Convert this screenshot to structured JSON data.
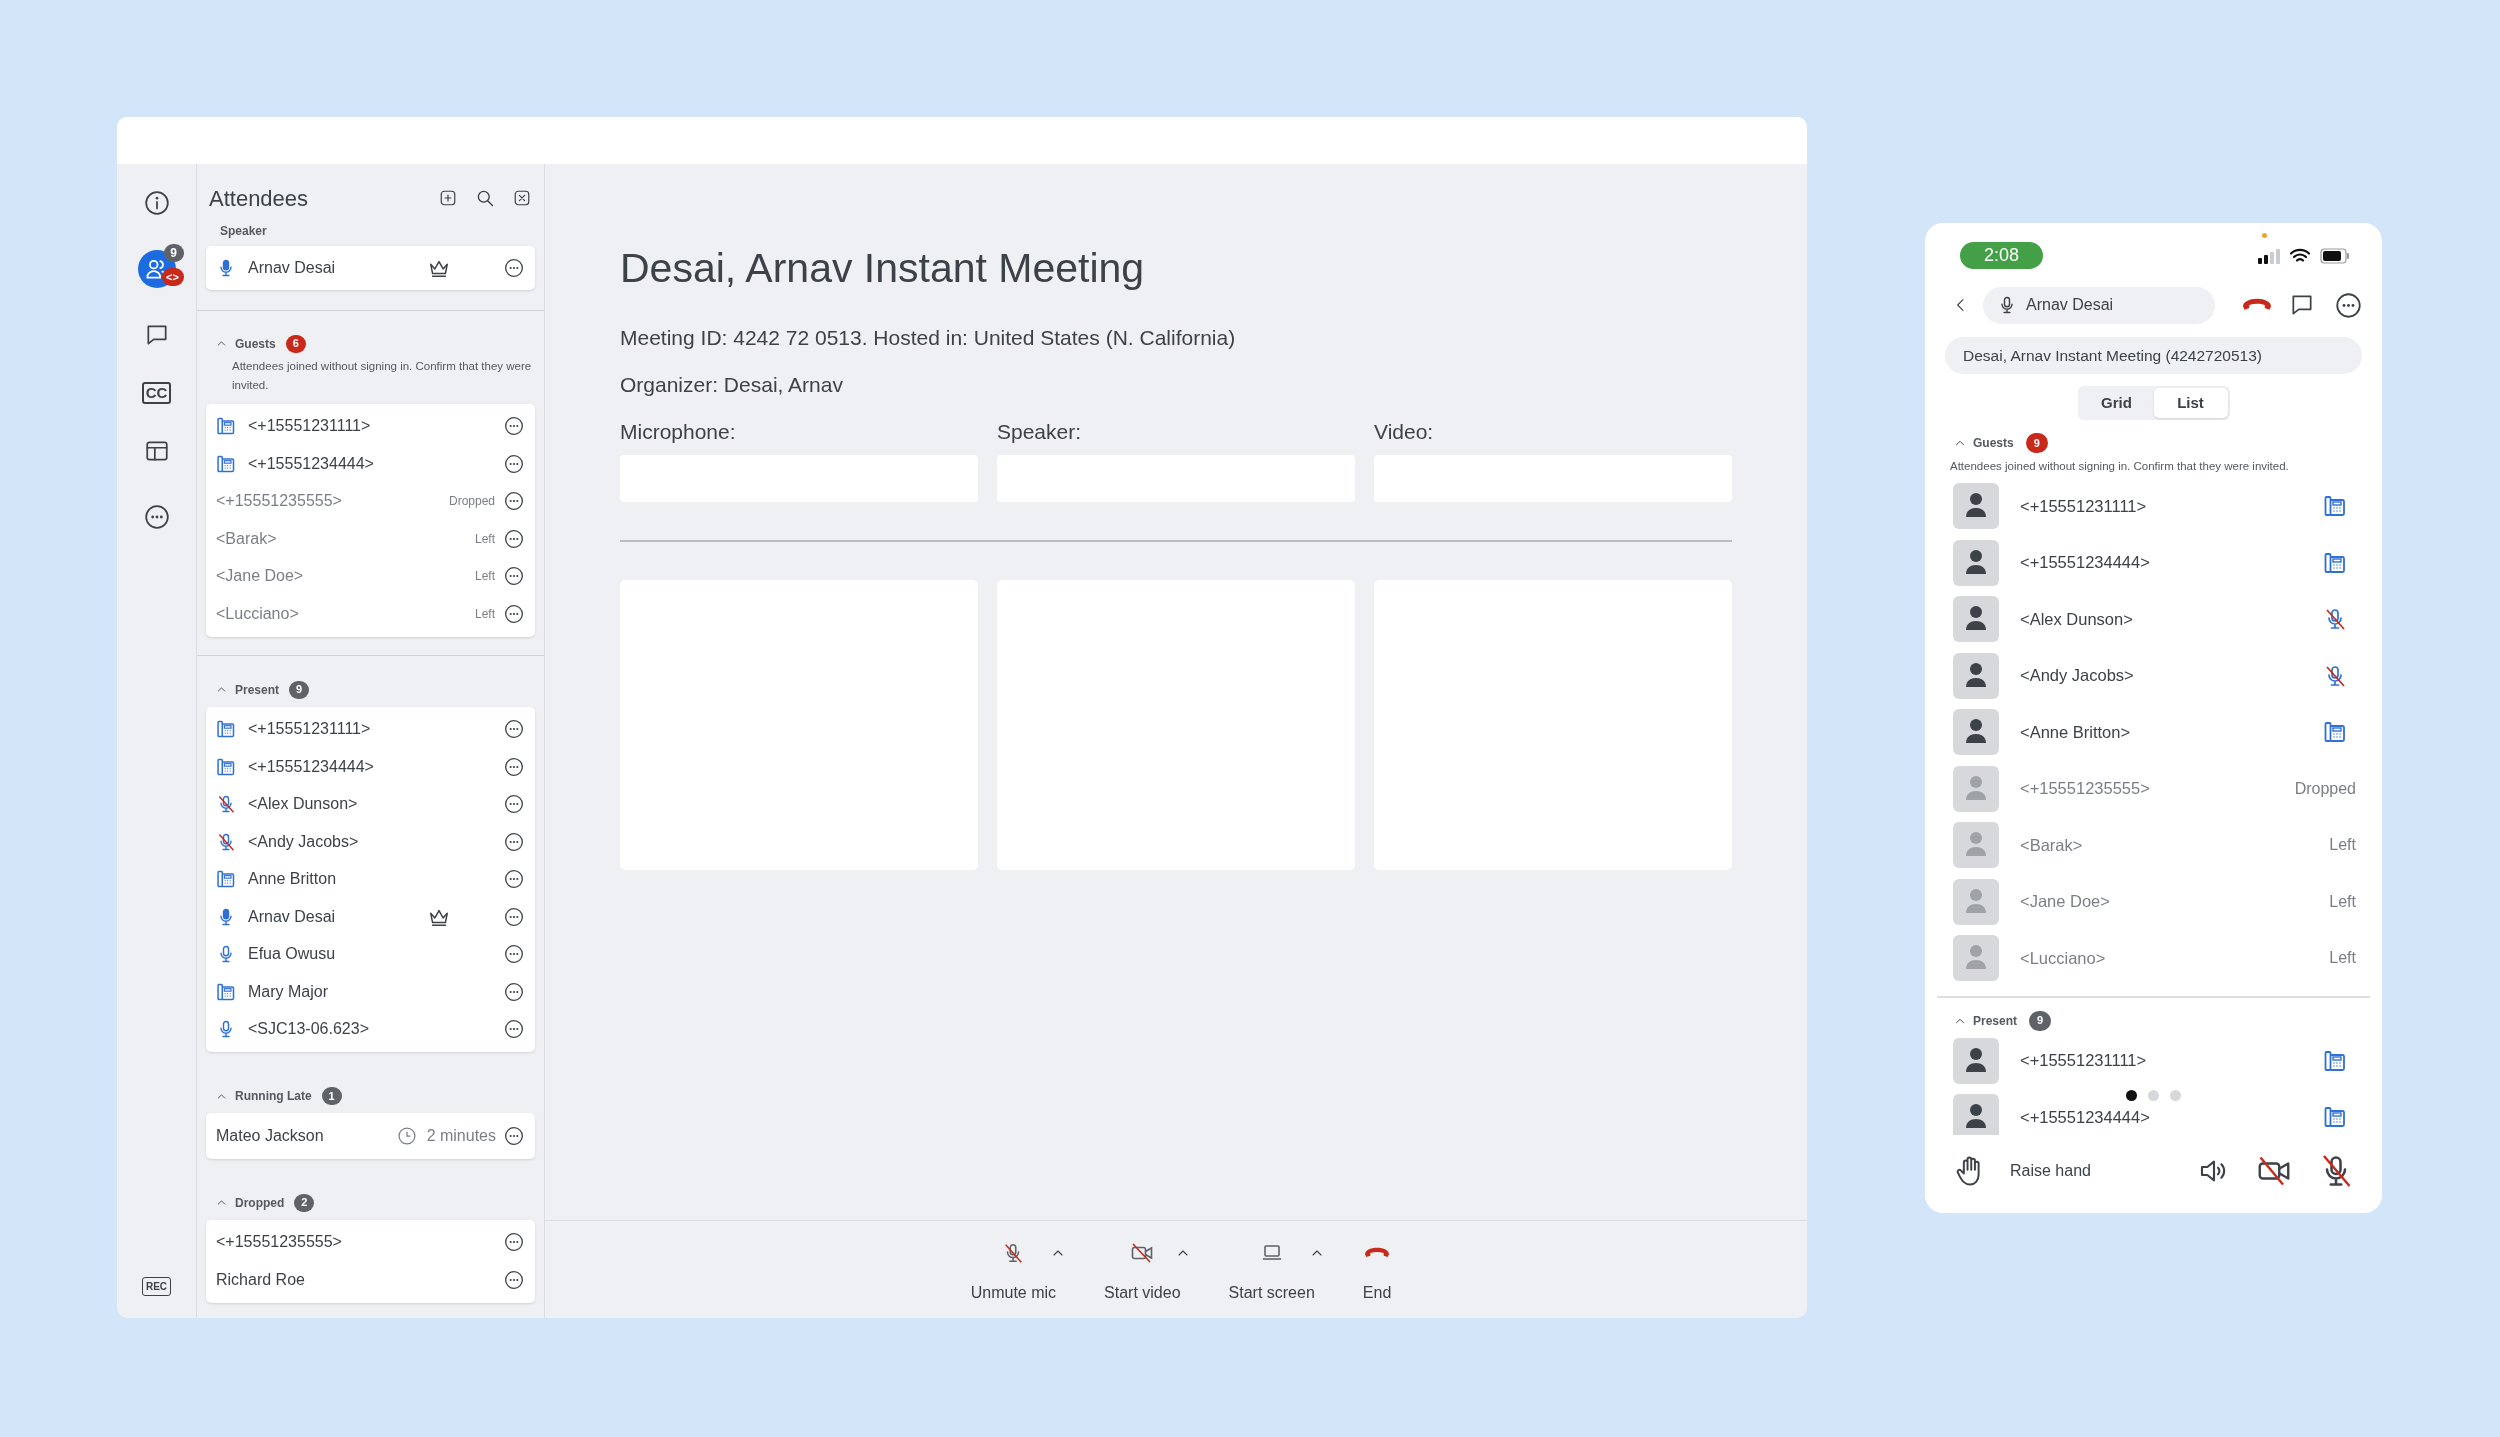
{
  "rail": {
    "items": [
      {
        "kind": "info",
        "selected": false
      },
      {
        "kind": "attendees",
        "selected": true,
        "count": "9",
        "alert": "<>"
      },
      {
        "kind": "chat",
        "selected": false
      },
      {
        "kind": "captions",
        "selected": false,
        "label": "CC"
      },
      {
        "kind": "layout",
        "selected": false
      },
      {
        "kind": "more",
        "selected": false
      },
      {
        "kind": "record",
        "selected": false,
        "label": "REC"
      }
    ]
  },
  "attendees": {
    "title": "Attendees",
    "speaker_label": "Speaker",
    "speaker": {
      "name": "Arnav Desai",
      "kind": "mic_speaking",
      "host": true
    },
    "sections": [
      {
        "title": "Guests",
        "count": "6",
        "alert": true,
        "expanded": true,
        "divider": true,
        "note": "Attendees joined without signing in. Confirm that they were invited.",
        "rows": [
          {
            "name": "<+15551231111>",
            "kind": "desk_phone",
            "inactive": false
          },
          {
            "name": "<+15551234444>",
            "kind": "desk_phone",
            "inactive": false
          },
          {
            "name": "<+15551235555>",
            "status": "Dropped",
            "inactive": true
          },
          {
            "name": "<Barak>",
            "status": "Left",
            "inactive": true
          },
          {
            "name": "<Jane Doe>",
            "status": "Left",
            "inactive": true
          },
          {
            "name": "<Lucciano>",
            "status": "Left",
            "inactive": true
          }
        ]
      },
      {
        "title": "Present",
        "count": "9",
        "alert": false,
        "expanded": true,
        "divider": false,
        "rows": [
          {
            "name": "<+15551231111>",
            "kind": "desk_phone",
            "inactive": false
          },
          {
            "name": "<+15551234444>",
            "kind": "desk_phone",
            "inactive": false
          },
          {
            "name": "<Alex Dunson>",
            "kind": "mic_muted",
            "inactive": false
          },
          {
            "name": "<Andy Jacobs>",
            "kind": "mic_muted",
            "inactive": false
          },
          {
            "name": "Anne Britton",
            "kind": "desk_phone",
            "inactive": false
          },
          {
            "name": "Arnav Desai",
            "kind": "mic_speaking",
            "host": true,
            "inactive": false
          },
          {
            "name": "Efua Owusu",
            "kind": "mic",
            "inactive": false
          },
          {
            "name": "Mary Major",
            "kind": "desk_phone",
            "inactive": false
          },
          {
            "name": "<SJC13-06.623>",
            "kind": "mic",
            "inactive": false
          }
        ]
      },
      {
        "title": "Running Late",
        "count": "1",
        "alert": false,
        "expanded": true,
        "divider": false,
        "rows": [
          {
            "name": "Mateo Jackson",
            "late_by": "2 minutes",
            "inactive": false
          }
        ]
      },
      {
        "title": "Dropped",
        "count": "2",
        "alert": false,
        "expanded": true,
        "divider": false,
        "rows": [
          {
            "name": "<+15551235555>",
            "inactive": false
          },
          {
            "name": "Richard Roe",
            "inactive": false
          }
        ]
      }
    ]
  },
  "meeting": {
    "title": "Desai, Arnav Instant Meeting",
    "details": "Meeting ID: 4242 72 0513. Hosted in: United States (N. California)",
    "organizer": "Organizer: Desai, Arnav",
    "devices": [
      {
        "label": "Microphone:"
      },
      {
        "label": "Speaker:"
      },
      {
        "label": "Video:"
      }
    ],
    "tiles": [
      {
        "kind": "empty"
      },
      {
        "kind": "empty"
      },
      {
        "kind": "empty"
      }
    ]
  },
  "toolbar": [
    {
      "label": "Unmute mic",
      "kind": "mic_muted",
      "menu": true
    },
    {
      "label": "Start video",
      "kind": "video_off",
      "menu": true
    },
    {
      "label": "Start screen",
      "kind": "screen",
      "menu": true
    },
    {
      "label": "End",
      "kind": "hang_up",
      "menu": false
    }
  ],
  "phone": {
    "status_bar": {
      "time": "2:08"
    },
    "header": {
      "name": "Arnav Desai"
    },
    "meeting_title": "Desai, Arnav Instant Meeting (4242720513)",
    "view_toggle": [
      {
        "label": "Grid",
        "selected": false
      },
      {
        "label": "List",
        "selected": true
      }
    ],
    "sections": [
      {
        "title": "Guests",
        "count": "9",
        "alert": true,
        "expanded": true,
        "note": "Attendees joined without signing in. Confirm that they were invited.",
        "rows": [
          {
            "name": "<+15551231111>",
            "kind": "desk_phone",
            "inactive": false
          },
          {
            "name": "<+15551234444>",
            "kind": "desk_phone",
            "inactive": false
          },
          {
            "name": "<Alex Dunson>",
            "kind": "mic_muted",
            "inactive": false
          },
          {
            "name": "<Andy Jacobs>",
            "kind": "mic_muted",
            "inactive": false
          },
          {
            "name": "<Anne Britton>",
            "kind": "desk_phone",
            "inactive": false
          },
          {
            "name": "<+15551235555>",
            "status": "Dropped",
            "inactive": true
          },
          {
            "name": "<Barak>",
            "status": "Left",
            "inactive": true
          },
          {
            "name": "<Jane Doe>",
            "status": "Left",
            "inactive": true
          },
          {
            "name": "<Lucciano>",
            "status": "Left",
            "inactive": true
          }
        ]
      },
      {
        "title": "Present",
        "count": "9",
        "alert": false,
        "expanded": true,
        "rows": [
          {
            "name": "<+15551231111>",
            "kind": "desk_phone",
            "inactive": false
          },
          {
            "name": "<+15551234444>",
            "kind": "desk_phone",
            "inactive": false
          }
        ]
      }
    ],
    "pager": [
      {
        "selected": true
      },
      {
        "selected": false
      },
      {
        "selected": false
      }
    ],
    "raise_hand": "Raise hand"
  }
}
